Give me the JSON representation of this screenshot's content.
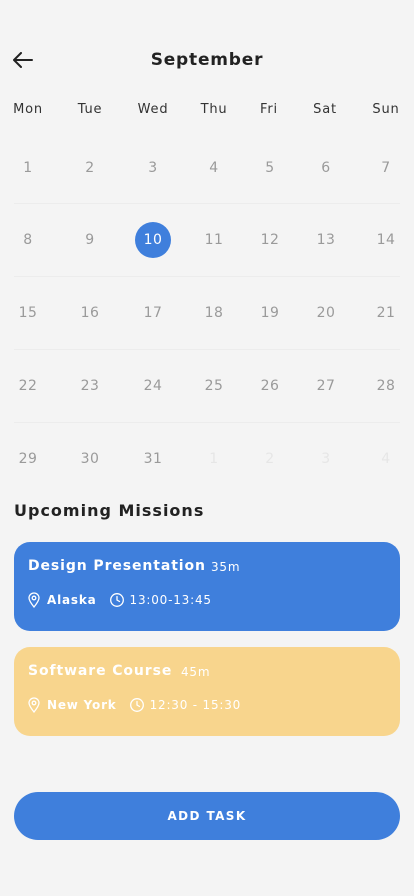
{
  "header": {
    "title": "September"
  },
  "weekdays": [
    "Mon",
    "Tue",
    "Wed",
    "Thu",
    "Fri",
    "Sat",
    "Sun"
  ],
  "calendar": {
    "selected_day": "10",
    "weeks": [
      [
        "1",
        "2",
        "3",
        "4",
        "5",
        "6",
        "7"
      ],
      [
        "8",
        "9",
        "10",
        "11",
        "12",
        "13",
        "14"
      ],
      [
        "15",
        "16",
        "17",
        "18",
        "19",
        "20",
        "21"
      ],
      [
        "22",
        "23",
        "24",
        "25",
        "26",
        "27",
        "28"
      ],
      [
        "29",
        "30",
        "31",
        "1",
        "2",
        "3",
        "4"
      ]
    ],
    "muted_cells": [
      [
        4,
        3
      ],
      [
        4,
        4
      ],
      [
        4,
        5
      ],
      [
        4,
        6
      ]
    ]
  },
  "missions": {
    "title": "Upcoming Missions",
    "items": [
      {
        "title": "Design Presentation",
        "duration": "35m",
        "location": "Alaska",
        "time": "13:00-13:45",
        "color": "#3f7fdc"
      },
      {
        "title": "Software Course",
        "duration": "45m",
        "location": "New York",
        "time": "12:30 - 15:30",
        "color": "#f8d58d"
      }
    ]
  },
  "actions": {
    "add_task": "ADD TASK"
  },
  "colors": {
    "accent": "#3f7fdc",
    "secondary": "#f8d58d",
    "background": "#f4f4f4"
  },
  "icons": [
    "back-arrow-icon",
    "location-pin-icon",
    "clock-icon"
  ]
}
